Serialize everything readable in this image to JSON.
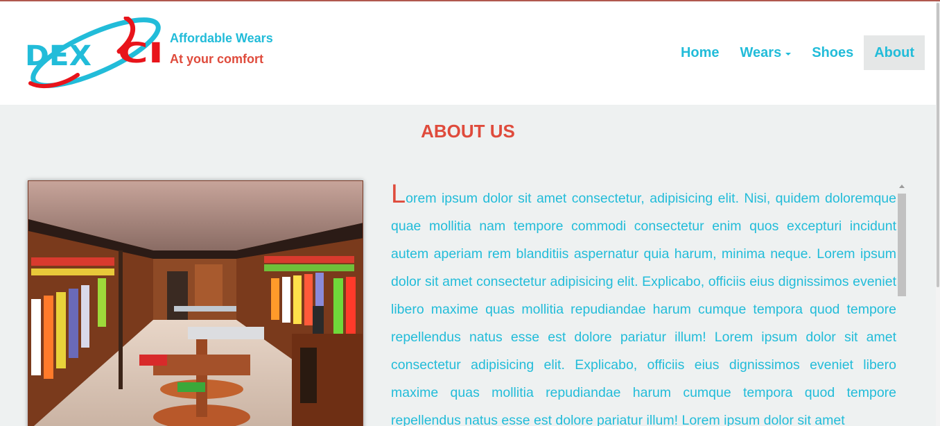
{
  "brand": {
    "name": "DEXCI",
    "tagline_line1": "Affordable Wears",
    "tagline_line2": "At your comfort",
    "colors": {
      "primary": "#22bcd9",
      "accent": "#df4b3c",
      "logo_red": "#e8141b"
    }
  },
  "nav": {
    "items": [
      {
        "label": "Home"
      },
      {
        "label": "Wears"
      },
      {
        "label": "Shoes"
      },
      {
        "label": "About"
      }
    ],
    "active": "About"
  },
  "about": {
    "title": "ABOUT US",
    "dropcap": "L",
    "paragraph": "orem ipsum dolor sit amet consectetur, adipisicing elit. Nisi, quidem doloremque quae mollitia nam tempore commodi consectetur enim quos excepturi incidunt autem aperiam rem blanditiis aspernatur quia harum, minima neque. Lorem ipsum dolor sit amet consectetur adipisicing elit. Explicabo, officiis eius dignissimos eveniet libero maxime quas mollitia repudiandae harum cumque tempora quod tempore repellendus natus esse est dolore pariatur illum! Lorem ipsum dolor sit amet consectetur adipisicing elit. Explicabo, officiis eius dignissimos eveniet libero maxime quas mollitia repudiandae harum cumque tempora quod tempore repellendus natus esse est dolore pariatur illum! Lorem ipsum dolor sit amet"
  },
  "icons": {
    "dropdown": "caret-down-icon",
    "scroll_up": "scroll-up-arrow-icon"
  }
}
